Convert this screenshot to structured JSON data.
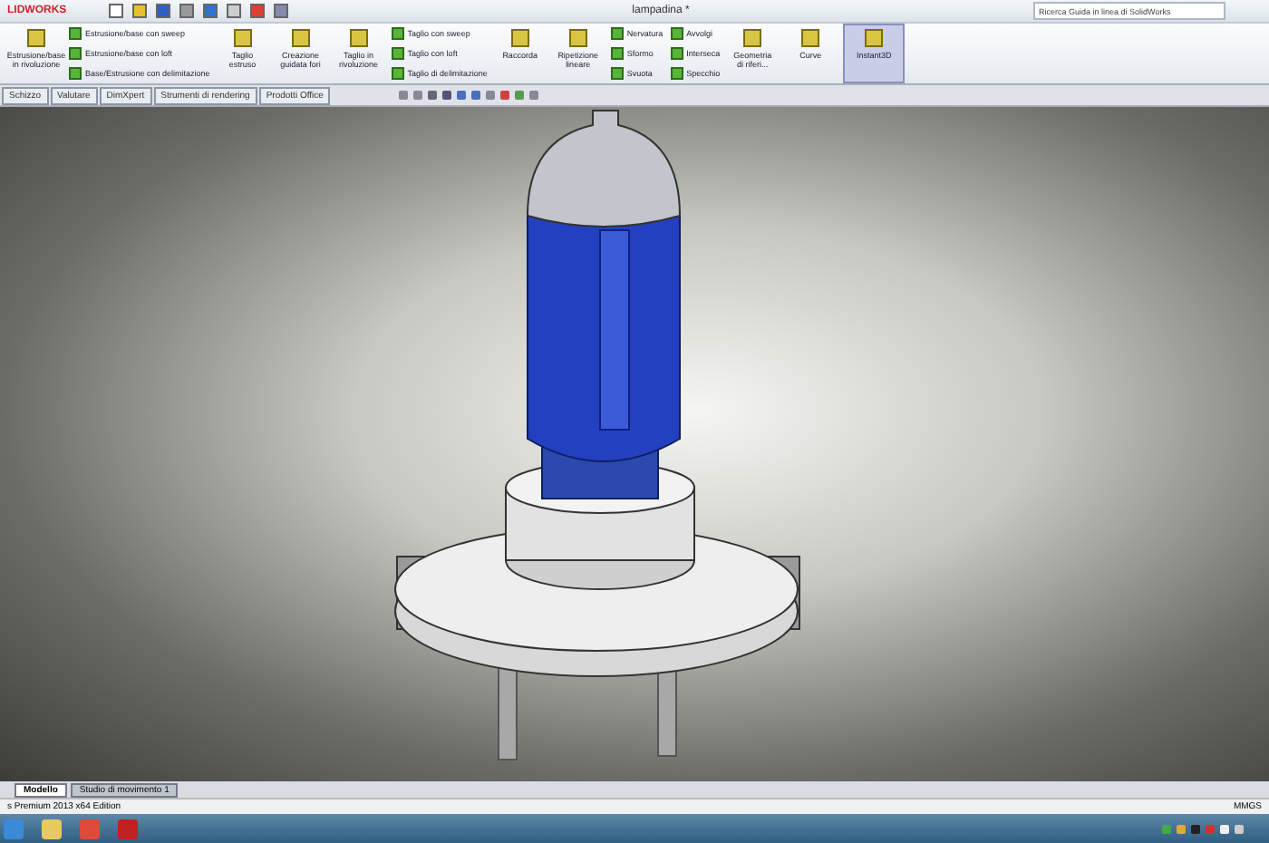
{
  "app": {
    "logo": "LIDWORKS",
    "title": "lampadina *",
    "search": {
      "placeholder": "Ricerca Guida in linea di SolidWorks"
    }
  },
  "ribbon": [
    {
      "kind": "large",
      "label": "Estrusione/base in rivoluzione",
      "selected": false
    },
    {
      "kind": "stack",
      "items": [
        "Estrusione/base con sweep",
        "Estrusione/base con loft",
        "Base/Estrusione con delimitazione"
      ]
    },
    {
      "kind": "large",
      "label": "Taglio estruso",
      "selected": false
    },
    {
      "kind": "large",
      "label": "Creazione guidata fori",
      "selected": false
    },
    {
      "kind": "large",
      "label": "Taglio in rivoluzione",
      "selected": false
    },
    {
      "kind": "stack",
      "items": [
        "Taglio con sweep",
        "Taglio con loft",
        "Taglio di delimitazione"
      ]
    },
    {
      "kind": "large",
      "label": "Raccorda",
      "selected": false
    },
    {
      "kind": "large",
      "label": "Ripetizione lineare",
      "selected": false
    },
    {
      "kind": "stack",
      "items": [
        "Nervatura",
        "Sformo",
        "Svuota"
      ]
    },
    {
      "kind": "stack",
      "items": [
        "Avvolgi",
        "Interseca",
        "Specchio"
      ]
    },
    {
      "kind": "large",
      "label": "Geometria di riferi...",
      "selected": false
    },
    {
      "kind": "large",
      "label": "Curve",
      "selected": false
    },
    {
      "kind": "large",
      "label": "Instant3D",
      "selected": true
    }
  ],
  "tabs": [
    {
      "label": "Schizzo",
      "selected": false
    },
    {
      "label": "Valutare",
      "selected": false
    },
    {
      "label": "DimXpert",
      "selected": false
    },
    {
      "label": "Strumenti di rendering",
      "selected": false
    },
    {
      "label": "Prodotti Office",
      "selected": false
    }
  ],
  "model_tabs": [
    {
      "label": "Modello",
      "selected": true
    },
    {
      "label": "Studio di movimento 1",
      "selected": false
    }
  ],
  "status_bar": {
    "left": "s Premium 2013 x64 Edition",
    "right": "MMGS"
  }
}
